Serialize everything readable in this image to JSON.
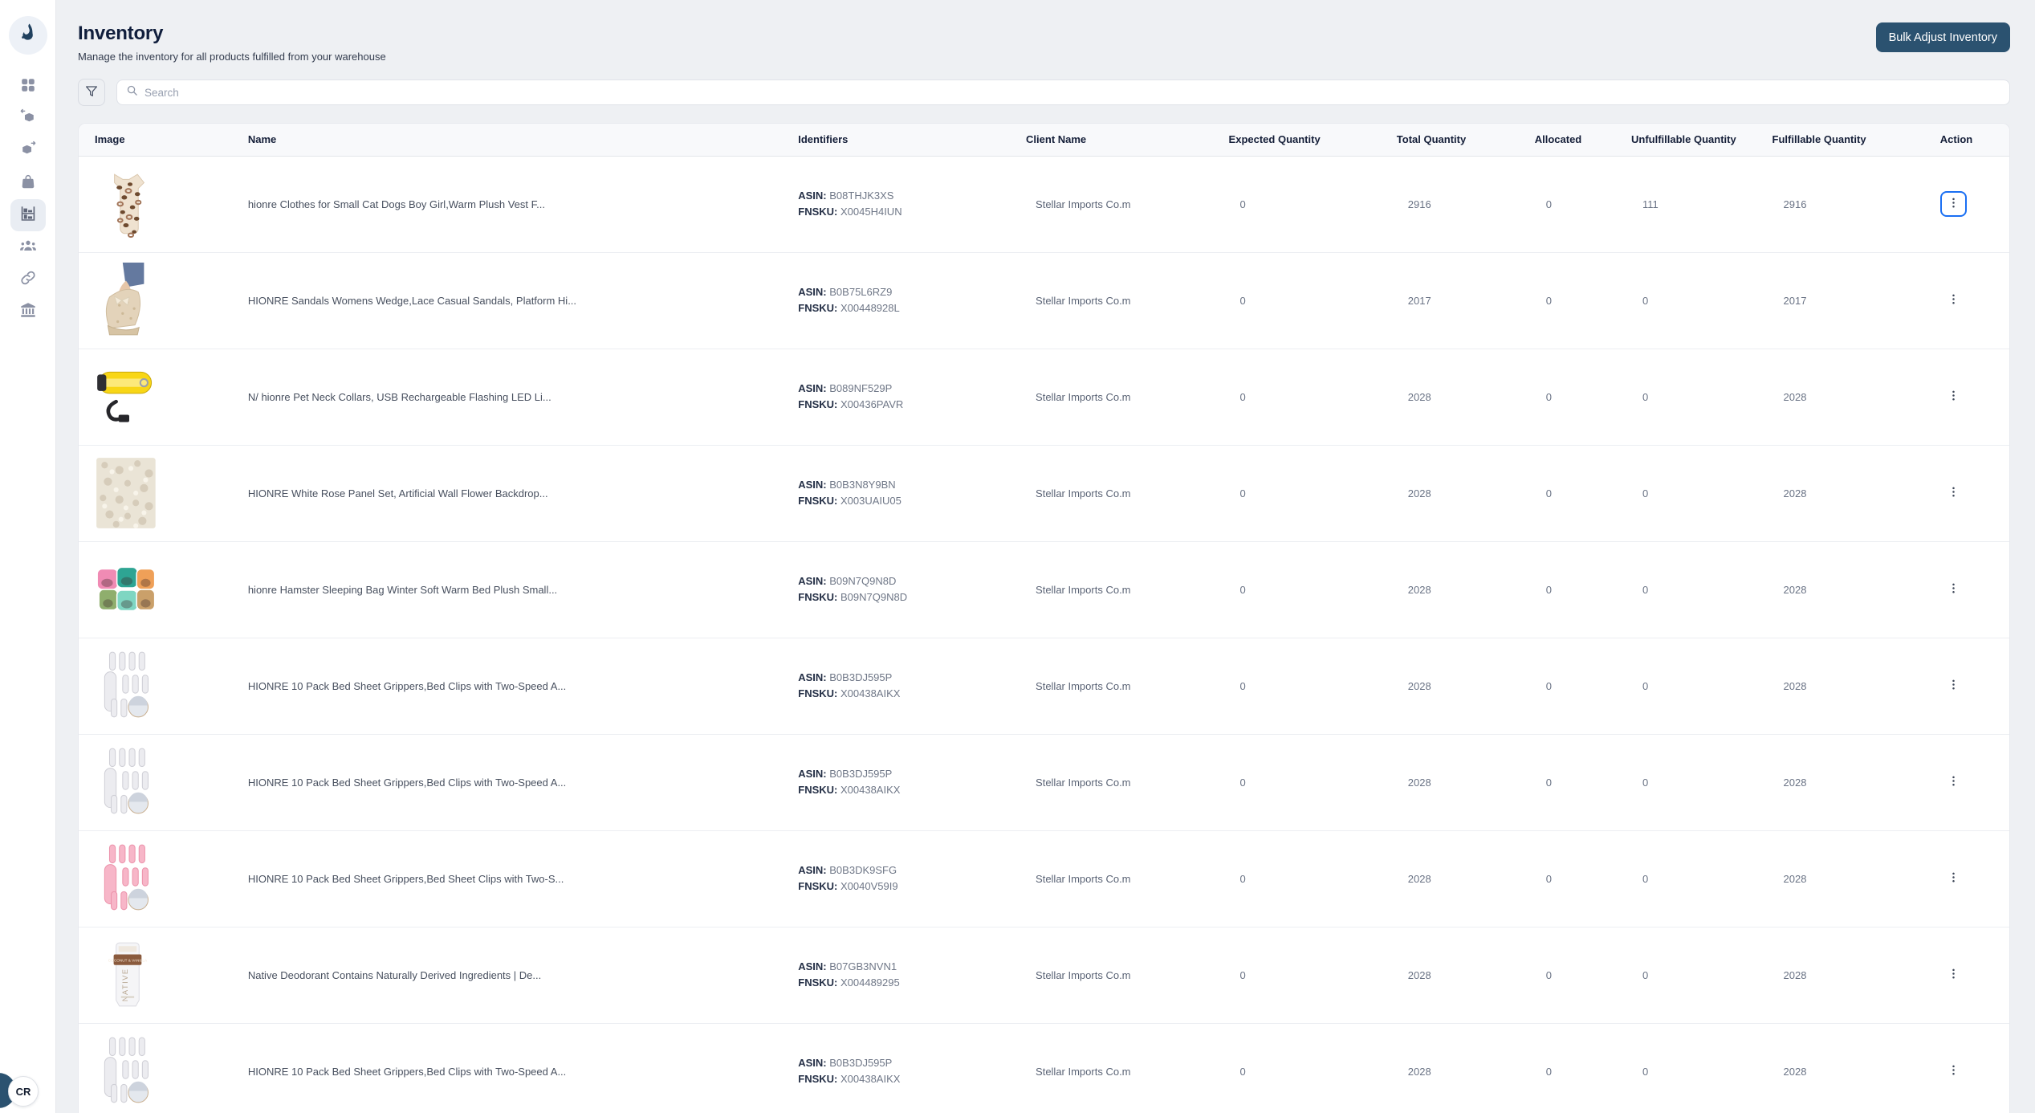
{
  "colors": {
    "primary_button": "#2b5270",
    "focus_ring": "#1a6ff3",
    "page_background": "#eef0f3",
    "active_nav_background": "#e9edf3",
    "table_header_background": "#f8f9fb",
    "title_text": "#101e3c"
  },
  "sidebar": {
    "logo_icon": "flame-logo-icon",
    "items": [
      {
        "id": "dashboard",
        "icon": "grid-icon",
        "active": false
      },
      {
        "id": "receiving",
        "icon": "cube-arrow-left-icon",
        "active": false
      },
      {
        "id": "shipping",
        "icon": "cube-arrow-right-icon",
        "active": false
      },
      {
        "id": "orders",
        "icon": "bag-icon",
        "active": false
      },
      {
        "id": "inventory",
        "icon": "shelf-icon",
        "active": true
      },
      {
        "id": "team",
        "icon": "people-icon",
        "active": false
      },
      {
        "id": "integrations",
        "icon": "link-icon",
        "active": false
      },
      {
        "id": "billing",
        "icon": "bank-icon",
        "active": false
      }
    ],
    "avatar_initials": "CR"
  },
  "header": {
    "title": "Inventory",
    "subtitle": "Manage the inventory for all products fulfilled from your warehouse",
    "bulk_button_label": "Bulk Adjust Inventory"
  },
  "toolbar": {
    "search_placeholder": "Search",
    "filter_icon": "funnel-icon",
    "search_icon": "search-icon"
  },
  "table": {
    "columns": [
      "Image",
      "Name",
      "Identifiers",
      "Client Name",
      "Expected Quantity",
      "Total Quantity",
      "Allocated",
      "Unfulfillable Quantity",
      "Fulfillable Quantity",
      "Action"
    ],
    "identifier_labels": {
      "asin": "ASIN:",
      "fnsku": "FNSKU:"
    },
    "row_action_icon": "kebab-menu-icon",
    "rows": [
      {
        "image_kind": "leopard-vest",
        "name": "hionre Clothes for Small Cat Dogs Boy Girl,Warm Plush Vest F...",
        "asin": "B08THJK3XS",
        "fnsku": "X0045H4IUN",
        "client": "Stellar Imports Co.m",
        "expected": 0,
        "total": 2916,
        "allocated": 0,
        "unfulfillable": 111,
        "fulfillable": 2916,
        "action_focused": true
      },
      {
        "image_kind": "wedge-sandals",
        "name": "HIONRE Sandals Womens Wedge,Lace Casual Sandals, Platform Hi...",
        "asin": "B0B75L6RZ9",
        "fnsku": "X00448928L",
        "client": "Stellar Imports Co.m",
        "expected": 0,
        "total": 2017,
        "allocated": 0,
        "unfulfillable": 0,
        "fulfillable": 2017,
        "action_focused": false
      },
      {
        "image_kind": "yellow-collar",
        "name": "N/ hionre Pet Neck Collars, USB Rechargeable Flashing LED Li...",
        "asin": "B089NF529P",
        "fnsku": "X00436PAVR",
        "client": "Stellar Imports Co.m",
        "expected": 0,
        "total": 2028,
        "allocated": 0,
        "unfulfillable": 0,
        "fulfillable": 2028,
        "action_focused": false
      },
      {
        "image_kind": "rose-panel",
        "name": "HIONRE White Rose Panel Set, Artificial Wall Flower Backdrop...",
        "asin": "B0B3N8Y9BN",
        "fnsku": "X003UAIU05",
        "client": "Stellar Imports Co.m",
        "expected": 0,
        "total": 2028,
        "allocated": 0,
        "unfulfillable": 0,
        "fulfillable": 2028,
        "action_focused": false
      },
      {
        "image_kind": "hamster-beds",
        "name": "hionre Hamster Sleeping Bag Winter Soft Warm Bed Plush Small...",
        "asin": "B09N7Q9N8D",
        "fnsku": "B09N7Q9N8D",
        "client": "Stellar Imports Co.m",
        "expected": 0,
        "total": 2028,
        "allocated": 0,
        "unfulfillable": 0,
        "fulfillable": 2028,
        "action_focused": false
      },
      {
        "image_kind": "grippers-white",
        "name": "HIONRE 10 Pack Bed Sheet Grippers,Bed Clips with Two-Speed A...",
        "asin": "B0B3DJ595P",
        "fnsku": "X00438AIKX",
        "client": "Stellar Imports Co.m",
        "expected": 0,
        "total": 2028,
        "allocated": 0,
        "unfulfillable": 0,
        "fulfillable": 2028,
        "action_focused": false
      },
      {
        "image_kind": "grippers-white",
        "name": "HIONRE 10 Pack Bed Sheet Grippers,Bed Clips with Two-Speed A...",
        "asin": "B0B3DJ595P",
        "fnsku": "X00438AIKX",
        "client": "Stellar Imports Co.m",
        "expected": 0,
        "total": 2028,
        "allocated": 0,
        "unfulfillable": 0,
        "fulfillable": 2028,
        "action_focused": false
      },
      {
        "image_kind": "grippers-pink",
        "name": "HIONRE 10 Pack Bed Sheet Grippers,Bed Sheet Clips with Two-S...",
        "asin": "B0B3DK9SFG",
        "fnsku": "X0040V59I9",
        "client": "Stellar Imports Co.m",
        "expected": 0,
        "total": 2028,
        "allocated": 0,
        "unfulfillable": 0,
        "fulfillable": 2028,
        "action_focused": false
      },
      {
        "image_kind": "deodorant",
        "name": "Native Deodorant Contains Naturally Derived Ingredients | De...",
        "asin": "B07GB3NVN1",
        "fnsku": "X004489295",
        "client": "Stellar Imports Co.m",
        "expected": 0,
        "total": 2028,
        "allocated": 0,
        "unfulfillable": 0,
        "fulfillable": 2028,
        "action_focused": false
      },
      {
        "image_kind": "grippers-white",
        "name": "HIONRE 10 Pack Bed Sheet Grippers,Bed Clips with Two-Speed A...",
        "asin": "B0B3DJ595P",
        "fnsku": "X00438AIKX",
        "client": "Stellar Imports Co.m",
        "expected": 0,
        "total": 2028,
        "allocated": 0,
        "unfulfillable": 0,
        "fulfillable": 2028,
        "action_focused": false
      }
    ]
  }
}
